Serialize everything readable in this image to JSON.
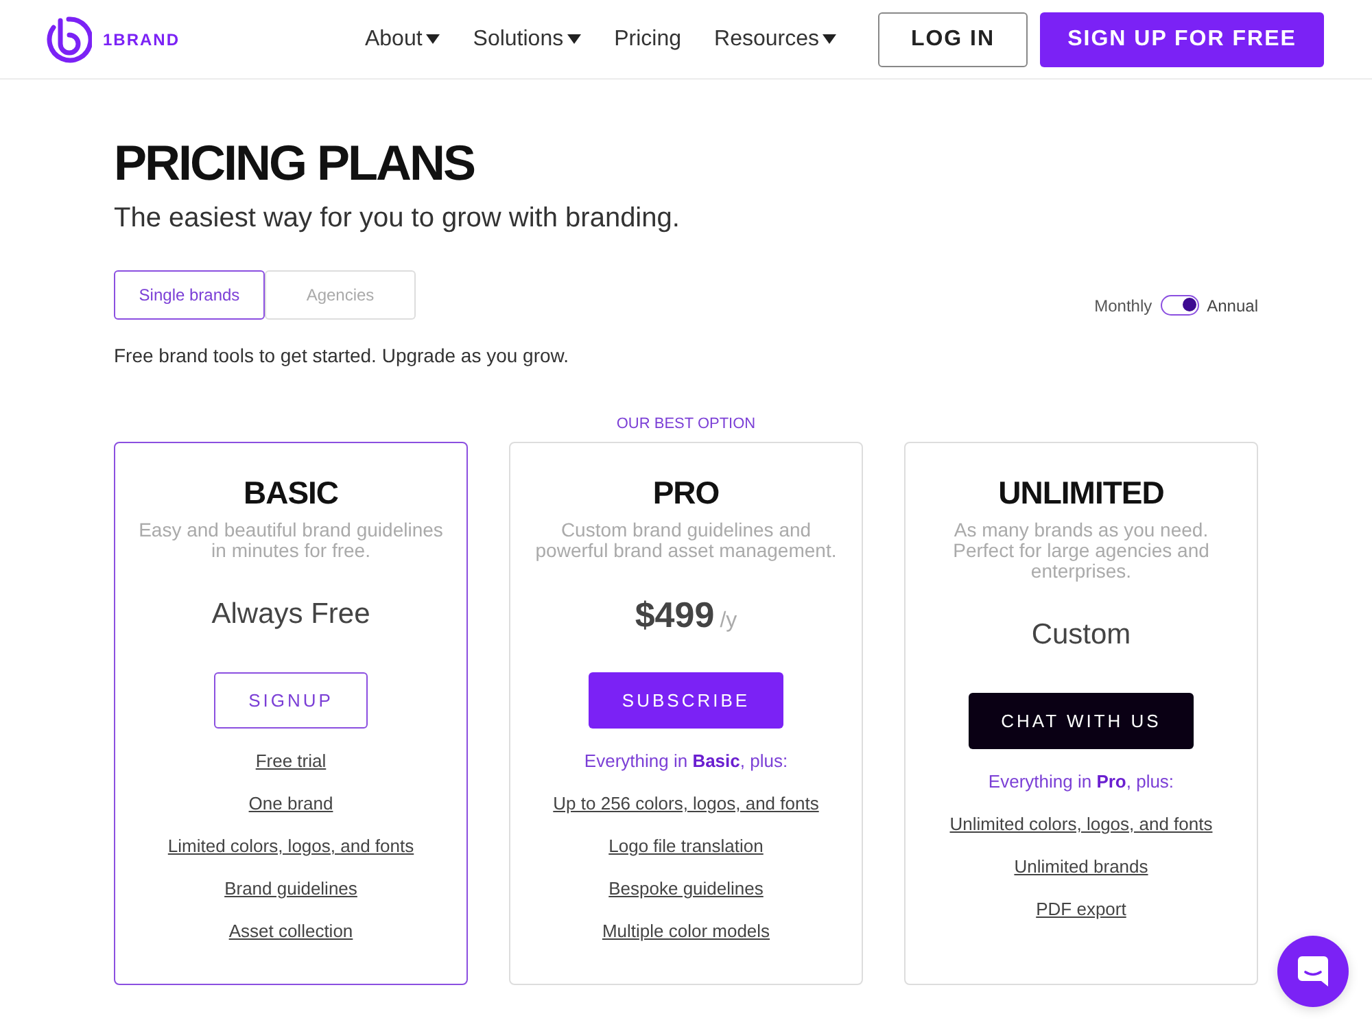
{
  "header": {
    "logo_text": "1BRAND",
    "nav": [
      {
        "label": "About",
        "dropdown": true
      },
      {
        "label": "Solutions",
        "dropdown": true
      },
      {
        "label": "Pricing",
        "dropdown": false
      },
      {
        "label": "Resources",
        "dropdown": true
      }
    ],
    "login_button": "LOG IN",
    "signup_button": "SIGN UP FOR FREE"
  },
  "hero": {
    "title": "PRICING PLANS",
    "subtitle": "The easiest way for you to grow with branding."
  },
  "audience_tabs": [
    {
      "label": "Single brands",
      "selected": true
    },
    {
      "label": "Agencies",
      "selected": false
    }
  ],
  "billing_toggle": {
    "left_label": "Monthly",
    "right_label": "Annual",
    "annual": true
  },
  "intro": "Free brand tools to get started. Upgrade as you grow.",
  "plans": [
    {
      "name": "BASIC",
      "selected": true,
      "description": "Easy and beautiful brand guidelines in minutes for free.",
      "price": "Always Free",
      "button": {
        "label": "SIGNUP",
        "kind": "outline"
      },
      "features": [
        "Free trial",
        "One brand",
        "Limited colors, logos, and fonts",
        "Brand guidelines",
        "Asset collection"
      ]
    },
    {
      "name": "PRO",
      "selected": false,
      "badge": "OUR BEST OPTION",
      "description": "Custom brand guidelines and powerful brand asset management.",
      "price": "$499",
      "period": "/y",
      "button": {
        "label": "SUBSCRIBE",
        "kind": "primary"
      },
      "includes": "Everything in **Basic**, plus:",
      "features": [
        "Up to 256 colors, logos, and fonts",
        "Logo file translation",
        "Bespoke guidelines",
        "Multiple color models"
      ]
    },
    {
      "name": "UNLIMITED",
      "selected": false,
      "description": "As many brands as you need. Perfect for large agencies and enterprises.",
      "price": "Custom",
      "button": {
        "label": "CHAT WITH US",
        "kind": "dark"
      },
      "includes": "Everything in **Pro**, plus:",
      "features": [
        "Unlimited colors, logos, and fonts",
        "Unlimited brands",
        "PDF export"
      ]
    }
  ]
}
